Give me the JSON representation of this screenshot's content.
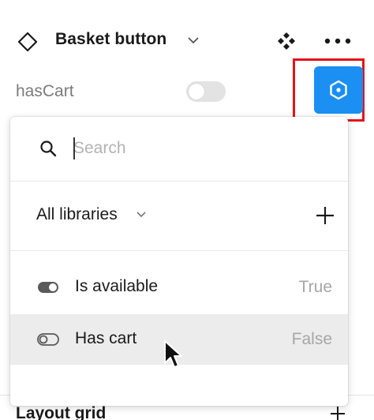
{
  "header": {
    "component_name": "Basket button"
  },
  "property": {
    "name": "hasCart",
    "toggle_on": false
  },
  "colors": {
    "accent": "#1b8ff2",
    "highlight": "#e3121b"
  },
  "dropdown": {
    "search_placeholder": "Search",
    "library_filter": "All libraries",
    "items": [
      {
        "label": "Is available",
        "value": "True",
        "toggle_on": true
      },
      {
        "label": "Has cart",
        "value": "False",
        "toggle_on": false
      }
    ]
  },
  "background_panel": {
    "section_label": "Layout grid"
  },
  "icons": {
    "component": "diamond-component-icon",
    "instance": "instance-four-diamond-icon",
    "more": "more-horizontal-icon",
    "link_property": "hexagon-link-icon",
    "search": "search-icon",
    "add": "plus-icon"
  }
}
